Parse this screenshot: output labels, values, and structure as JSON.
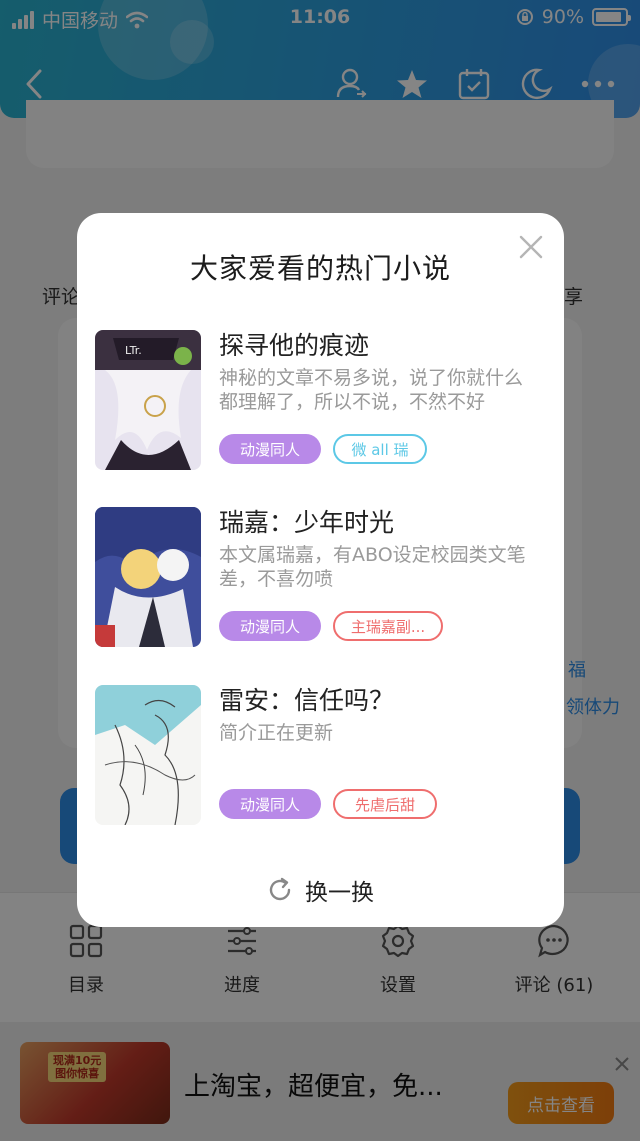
{
  "status_bar": {
    "carrier": "中国移动",
    "time": "11:06",
    "battery": "90%",
    "battery_level": 0.9
  },
  "background": {
    "left_label": "评论",
    "right_label": "享",
    "stamina_label": "领体力",
    "stamina_icon_text": "福"
  },
  "bottom_tabs": [
    {
      "label": "目录",
      "icon": "grid-icon"
    },
    {
      "label": "进度",
      "icon": "sliders-icon"
    },
    {
      "label": "设置",
      "icon": "gear-icon"
    },
    {
      "label": "评论 (61)",
      "icon": "comment-icon"
    }
  ],
  "ad": {
    "text": "上淘宝，超便宜，免...",
    "button": "点击查看",
    "image_label_1": "现满10元",
    "image_label_2": "图你惊喜"
  },
  "modal": {
    "title": "大家爱看的热门小说",
    "books": [
      {
        "title": "探寻他的痕迹",
        "description": "神秘的文章不易多说，说了你就什么都理解了，所以不说，不然不好",
        "tag": "动漫同人",
        "subtag": "微 all 瑞",
        "subtag_color": "#5cc8e6"
      },
      {
        "title": "瑞嘉：少年时光",
        "description": "本文属瑞嘉，有ABO设定校园类文笔差，不喜勿喷",
        "tag": "动漫同人",
        "subtag": "主瑞嘉副...",
        "subtag_color": "#ef6e6e"
      },
      {
        "title": "雷安：信任吗？",
        "description": "简介正在更新",
        "tag": "动漫同人",
        "subtag": "先虐后甜",
        "subtag_color": "#ef6e6e"
      }
    ],
    "refresh_label": "换一换"
  },
  "colors": {
    "header_start": "#2ab2cf",
    "header_end": "#2f8ee8",
    "tag_purple": "#b889e8",
    "ad_orange": "#f07a12"
  }
}
